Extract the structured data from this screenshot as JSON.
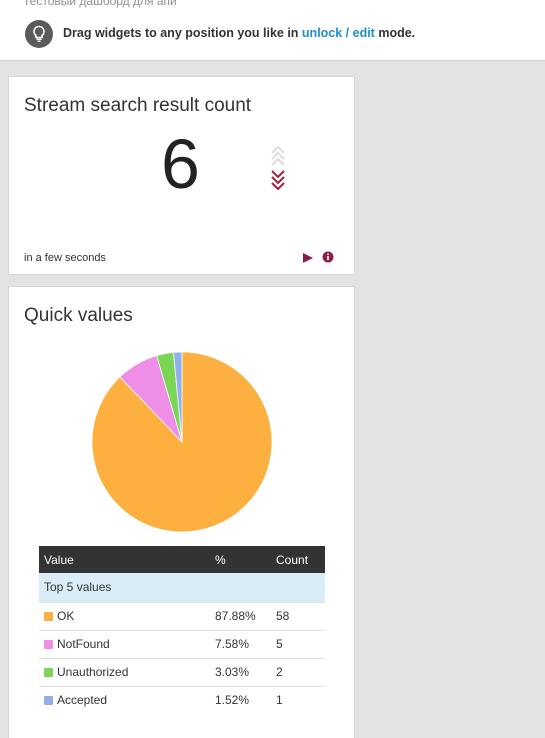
{
  "header": {
    "description": "Тестовый дашборд для апи",
    "hint_prefix": "Drag widgets to any position you like in ",
    "hint_link": "unlock / edit",
    "hint_suffix": " mode."
  },
  "count_widget": {
    "title": "Stream search result count",
    "value": "6",
    "updated": "in a few seconds",
    "trend_icon": "chevrons-down-icon",
    "accent": "#a3213d"
  },
  "quick_values": {
    "title": "Quick values",
    "table": {
      "headers": {
        "value": "Value",
        "percent": "%",
        "count": "Count"
      },
      "group_label": "Top 5 values",
      "rows": [
        {
          "value": "OK",
          "percent": "87.88%",
          "count": "58",
          "color": "#fdaf40"
        },
        {
          "value": "NotFound",
          "percent": "7.58%",
          "count": "5",
          "color": "#ef8ee7"
        },
        {
          "value": "Unauthorized",
          "percent": "3.03%",
          "count": "2",
          "color": "#7bd656"
        },
        {
          "value": "Accepted",
          "percent": "1.52%",
          "count": "1",
          "color": "#91afea"
        }
      ]
    }
  },
  "chart_data": {
    "type": "pie",
    "categories": [
      "OK",
      "NotFound",
      "Unauthorized",
      "Accepted"
    ],
    "values": [
      58,
      5,
      2,
      1
    ],
    "colors": [
      "#fdaf40",
      "#ef8ee7",
      "#7bd656",
      "#91afea"
    ]
  }
}
